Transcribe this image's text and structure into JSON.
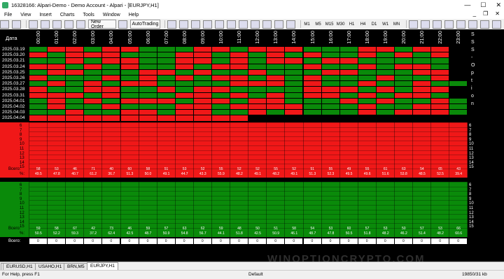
{
  "window": {
    "title": "16328166: Alpari-Demo - Demo Account - Alpari - [EURJPY,H1]",
    "minimize": "—",
    "maximize": "☐",
    "close": "✕"
  },
  "menu": {
    "items": [
      "File",
      "View",
      "Insert",
      "Charts",
      "Tools",
      "Window",
      "Help"
    ],
    "mdi": [
      "_",
      "❐",
      "✕"
    ]
  },
  "toolbar": {
    "new_order": "New Order",
    "autotrading": "AutoTrading",
    "timeframes": [
      "M1",
      "M5",
      "M15",
      "M30",
      "H1",
      "H4",
      "D1",
      "W1",
      "MN"
    ]
  },
  "grid": {
    "header_label": "Дата",
    "hours": [
      "00:00",
      "01:00",
      "02:00",
      "03:00",
      "04:00",
      "05:00",
      "06:00",
      "07:00",
      "08:00",
      "09:00",
      "10:00",
      "11:00",
      "12:00",
      "13:00",
      "14:00",
      "15:00",
      "16:00",
      "17:00",
      "18:00",
      "19:00",
      "20:00",
      "21:00",
      "22:00",
      "23:00"
    ],
    "dates": [
      "2025.03.19",
      "2025.03.20",
      "2025.03.21",
      "2025.03.24",
      "2025.03.25",
      "2025.03.26",
      "2025.03.27",
      "2025.03.28",
      "2025.03.31",
      "2025.04.01",
      "2025.04.02",
      "2025.04.03",
      "2025.04.04"
    ],
    "side_text": "SSS-Option",
    "colors": {
      "red": "#f01818",
      "green": "#0a8a0a",
      "black": "#000000"
    }
  },
  "stats": {
    "rows": [
      "6",
      "7",
      "8",
      "9",
      "10",
      "11",
      "12",
      "13",
      "14",
      "15"
    ],
    "total_label": "Всего:",
    "pct_label": "%:",
    "red_total": [
      "58",
      "53",
      "46",
      "71",
      "40",
      "60",
      "58",
      "51",
      "53",
      "52",
      "55",
      "52",
      "52",
      "55",
      "52",
      "51",
      "55",
      "49",
      "55",
      "61",
      "63",
      "54",
      "65",
      "43"
    ],
    "red_pct": [
      "49.5",
      "47.8",
      "40.7",
      "61.2",
      "36.7",
      "51.3",
      "50.0",
      "49.1",
      "44.7",
      "43.3",
      "55.9",
      "48.2",
      "49.1",
      "48.2",
      "49.1",
      "51.3",
      "52.3",
      "49.5",
      "49.6",
      "51.6",
      "53.8",
      "48.5",
      "52.5",
      "39.4"
    ],
    "green_total": [
      "59",
      "58",
      "67",
      "42",
      "73",
      "46",
      "59",
      "57",
      "63",
      "62",
      "59",
      "48",
      "50",
      "51",
      "58",
      "54",
      "53",
      "60",
      "57",
      "53",
      "50",
      "57",
      "53",
      "66"
    ],
    "green_pct": [
      "50.5",
      "52.2",
      "59.3",
      "37.2",
      "62.4",
      "42.5",
      "48.7",
      "50.9",
      "54.8",
      "56.7",
      "44.1",
      "51.8",
      "42.5",
      "50.9",
      "46.1",
      "48.7",
      "47.8",
      "50.5",
      "51.8",
      "48.2",
      "46.2",
      "51.4",
      "48.2",
      "60.6"
    ],
    "bottom_total": [
      "0",
      "0",
      "0",
      "0",
      "0",
      "0",
      "0",
      "0",
      "0",
      "0",
      "0",
      "0",
      "0",
      "0",
      "0",
      "0",
      "0",
      "0",
      "0",
      "0",
      "0",
      "0",
      "0",
      "0"
    ]
  },
  "tabs": [
    "EURUSD,H1",
    "USAHO,H1",
    "BRN,M5",
    "EURJPY,H1"
  ],
  "status": {
    "help": "For Help, press F1",
    "profile": "Default",
    "traffic": "19850/31 kb"
  },
  "watermark": "WINOPTIONCRYPTO.COM",
  "matrix": [
    "grrgrrgggrrgrrrgggrrgrrb",
    "rgrrrgggrrgrgrgrggrgrgrb",
    "ggrgrrggrrgrgrrgrrgggggb",
    "rrgrgrggrgrrgggrggrgrrgb",
    "grrgggrrgrggrgggrrgggrrb",
    "rgggrgrgrgrrgrgrgggrggrb",
    "grgrgrrggggrrrgrggrggrgg",
    "rggrrggrgrrggggrrrgrgrrb",
    "rrrgrgggrrgrgrgrrgrgrrgb",
    "grgrgrrrgrrgrrgggrgrggrg",
    "grggrgggrrgrrrrgggrggrrg",
    "ggrggrrgrrggrgrgggrgrrrg",
    "rrrrrrrrrrrrbbbbbbbbbbbb"
  ]
}
